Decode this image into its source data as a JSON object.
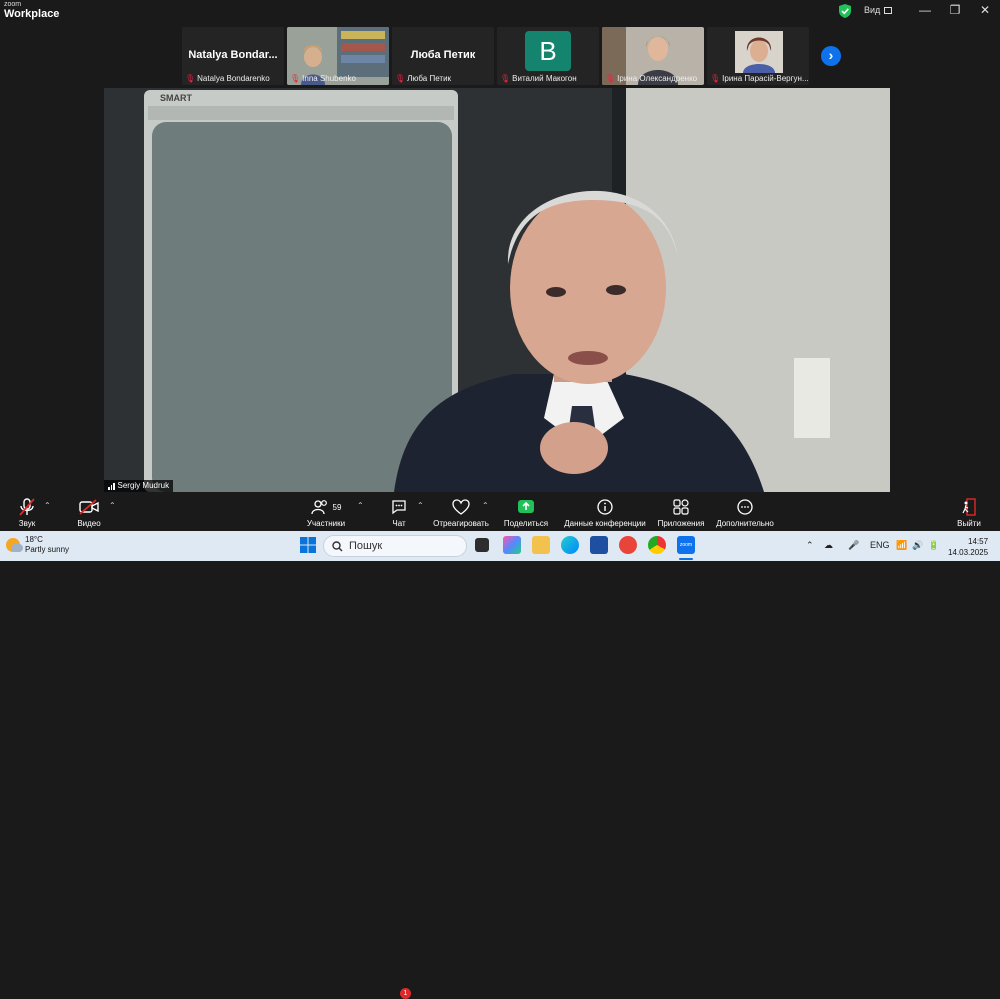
{
  "app": {
    "brand_top": "zoom",
    "brand_main": "Workplace",
    "view_label": "Вид"
  },
  "window_controls": {
    "minimize": "—",
    "restore": "❐",
    "close": "✕"
  },
  "participants": [
    {
      "big_name": "Natalya  Bondar...",
      "caption": "Natalya Bondarenko",
      "type": "name"
    },
    {
      "big_name": "",
      "caption": "Inna Shubenko",
      "type": "video"
    },
    {
      "big_name": "Люба Петик",
      "caption": "Люба Петик",
      "type": "name"
    },
    {
      "big_name": "B",
      "caption": "Виталий Макогон",
      "type": "avatar"
    },
    {
      "big_name": "",
      "caption": "Ірина Олександренко",
      "type": "video"
    },
    {
      "big_name": "",
      "caption": "Ірина Парасій-Вергун...",
      "type": "video"
    }
  ],
  "speaker": {
    "name": "Sergiy Mudruk",
    "whiteboard_brand": "SMART"
  },
  "toolbar": {
    "audio": "Звук",
    "video": "Видео",
    "participants": "Участники",
    "participants_count": "59",
    "chat": "Чат",
    "chat_badge": "1",
    "react": "Отреагировать",
    "share": "Поделиться",
    "meeting_info": "Данные конференции",
    "apps": "Приложения",
    "more": "Дополнительно",
    "leave": "Выйти"
  },
  "taskbar": {
    "temp": "18°C",
    "weather": "Partly sunny",
    "search_placeholder": "Пошук",
    "lang": "ENG",
    "time": "14:57",
    "date": "14.03.2025",
    "zoom_label": "zoom"
  },
  "colors": {
    "accent": "#0e72ed",
    "share_green": "#23c05a",
    "muted_red": "#e02828",
    "avatar_green": "#15846e"
  }
}
